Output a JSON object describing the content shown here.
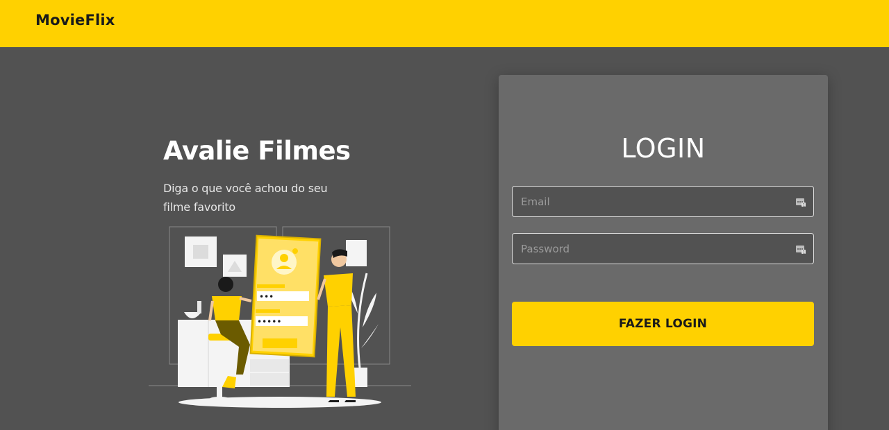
{
  "navbar": {
    "brand": "MovieFlix",
    "color": "#FFD100"
  },
  "hero": {
    "title": "Avalie Filmes",
    "subtitle": "Diga o que você achou do seu filme favorito"
  },
  "illustration": {
    "password_dots_1": "•••",
    "password_dots_2": "•••••"
  },
  "login": {
    "title": "LOGIN",
    "email_placeholder": "Email",
    "email_value": "",
    "password_placeholder": "Password",
    "password_value": "",
    "field_icon": "password-manager-icon",
    "submit_label": "FAZER LOGIN"
  },
  "colors": {
    "accent": "#FFD100",
    "background": "#525252",
    "card": "#6a6a6a"
  }
}
